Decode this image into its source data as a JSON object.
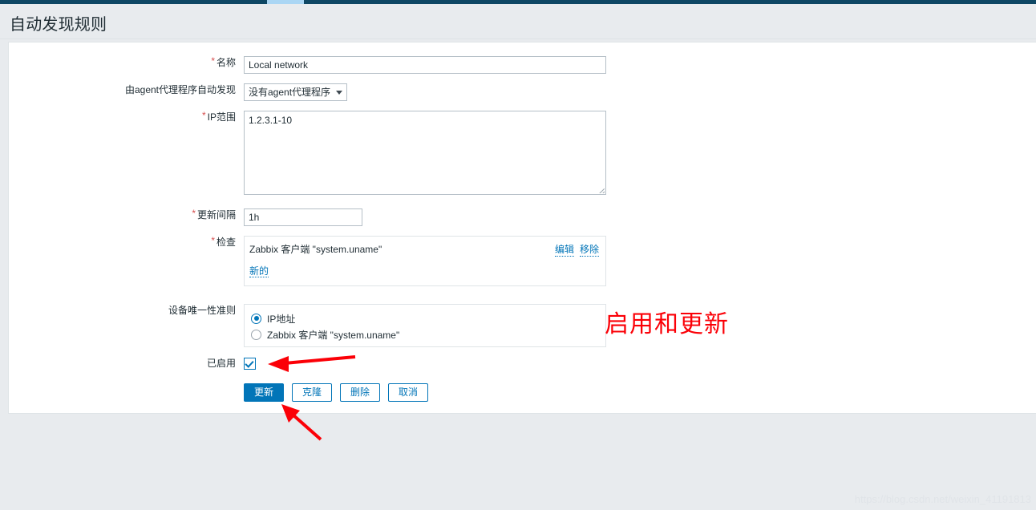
{
  "topbar": {
    "active_tab_marker": "active-tab"
  },
  "header": {
    "title": "自动发现规则"
  },
  "form": {
    "name": {
      "label": "名称",
      "required": true,
      "value": "Local network",
      "placeholder": ""
    },
    "proxy": {
      "label": "由agent代理程序自动发现",
      "required": false,
      "selected": "没有agent代理程序",
      "options": [
        "没有agent代理程序"
      ]
    },
    "ip_range": {
      "label": "IP范围",
      "required": true,
      "value": "1.2.3.1-10",
      "placeholder": ""
    },
    "update_interval": {
      "label": "更新间隔",
      "required": true,
      "value": "1h",
      "placeholder": ""
    },
    "checks": {
      "label": "检查",
      "required": true,
      "items": [
        {
          "name": "Zabbix 客户端 \"system.uname\"",
          "edit_label": "编辑",
          "remove_label": "移除"
        }
      ],
      "new_label": "新的"
    },
    "unique_criteria": {
      "label": "设备唯一性准则",
      "required": false,
      "options": [
        {
          "label": "IP地址",
          "selected": true
        },
        {
          "label": "Zabbix 客户端 \"system.uname\"",
          "selected": false
        }
      ]
    },
    "enabled": {
      "label": "已启用",
      "checked": true
    },
    "buttons": [
      {
        "label": "更新",
        "style": "primary"
      },
      {
        "label": "克隆",
        "style": "secondary"
      },
      {
        "label": "删除",
        "style": "secondary"
      },
      {
        "label": "取消",
        "style": "secondary"
      }
    ]
  },
  "annotations": {
    "red_note": "启用和更新",
    "red_color": "#fb0007",
    "arrow_count": 2
  },
  "watermark": {
    "text": "https://blog.csdn.net/weixin_41191813"
  },
  "colors": {
    "accent": "#0275b8",
    "topbar": "#0e4764",
    "topbar_active": "#aad6f4",
    "page_bg": "#e8ebee",
    "panel_bg": "#ffffff",
    "required_star": "#d64e4e"
  }
}
